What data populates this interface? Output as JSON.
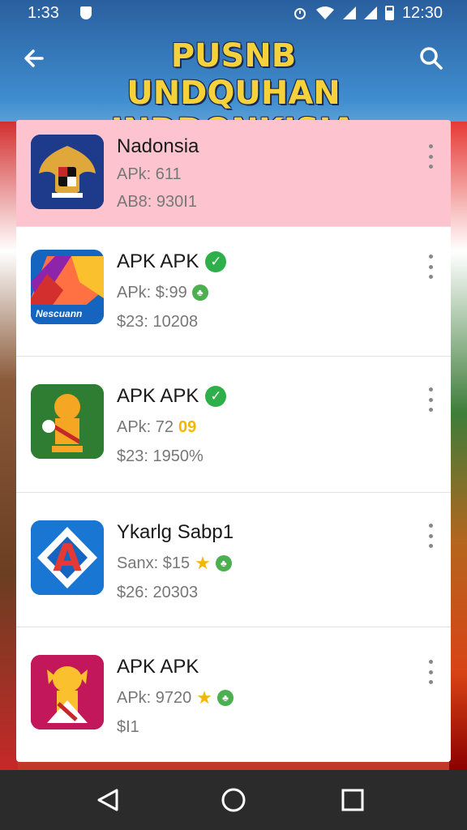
{
  "status_bar": {
    "time_left": "1:33",
    "time_right": "12:30"
  },
  "app_bar": {
    "title_line1": "PUSNB UNDQUHAN",
    "title_line2": "INDDONKISIA"
  },
  "apps": [
    {
      "name": "Nadonsia",
      "line1": "APk: 611",
      "line2": "AB8: 930I1",
      "verified": false
    },
    {
      "name": "APK APK",
      "line1": "APk: $:99",
      "line2": "$23: 10208",
      "verified": true
    },
    {
      "name": "APK APK",
      "line1": "APk: 72",
      "line1_extra": "09",
      "line2": "$23: 1950%",
      "verified": true
    },
    {
      "name": "Ykarlg Sabp1",
      "line1": "Sanx: $15",
      "line2": "$26: 20303",
      "verified": false
    },
    {
      "name": "APK APK",
      "line1": "APk: 9720",
      "line2": "$I1",
      "verified": false
    }
  ],
  "icon_texts": {
    "app2": "Nescuann"
  },
  "colors": {
    "title": "#f6d23a",
    "verified": "#2eaf4a",
    "highlight_row": "#fdc4cf",
    "nav_bar": "#2b2b2b"
  }
}
